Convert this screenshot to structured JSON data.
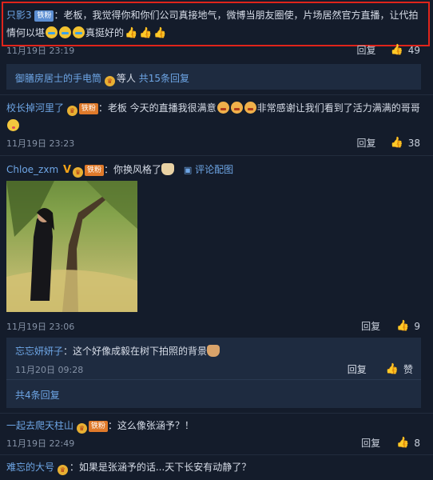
{
  "comments": [
    {
      "name": "只影3",
      "badge": "铁粉",
      "text_before": "：老板，我觉得你和你们公司真接地气，微博当朋友圈使，片场居然官方直播，让代拍",
      "text_line2": "情何以堪",
      "text_after": "真挺好的",
      "time": "11月19日 23:19",
      "reply_label": "回复",
      "likes": "49"
    },
    {
      "name": "校长掉河里了",
      "badge": "铁粉",
      "text_before": "：老板 今天的直播我很满意",
      "text_after": "非常感谢让我们看到了活力满满的哥哥",
      "time": "11月19日 23:23",
      "reply_label": "回复",
      "likes": "38"
    },
    {
      "name": "Chloe_zxm",
      "badge": "铁粉",
      "text": "：你换风格了",
      "image_link": "评论配图",
      "time": "11月19日 23:06",
      "reply_label": "回复",
      "likes": "9"
    },
    {
      "name": "一起去爬天柱山",
      "badge": "铁粉",
      "text": "：这么像张涵予？！",
      "time": "11月19日 22:49",
      "reply_label": "回复",
      "likes": "8"
    },
    {
      "name": "难忘的大号",
      "text": "：如果是张涵予的话...天下长安有动静了？"
    }
  ],
  "reply_summary_1": {
    "name": "御膳房居士的手电筒",
    "middle": "等人",
    "count": "共15条回复"
  },
  "sub_reply": {
    "name": "忘忘妍妍子",
    "text": "：这个好像成毅在树下拍照的背景",
    "time": "11月20日 09:28",
    "reply_label": "回复",
    "like_label": "赞"
  },
  "reply_summary_2": {
    "count": "共4条回复"
  },
  "colors": {
    "background": "#141c2b",
    "link": "#6ea6e6",
    "highlight_border": "#e0241b",
    "like_active": "#e24b3b"
  }
}
